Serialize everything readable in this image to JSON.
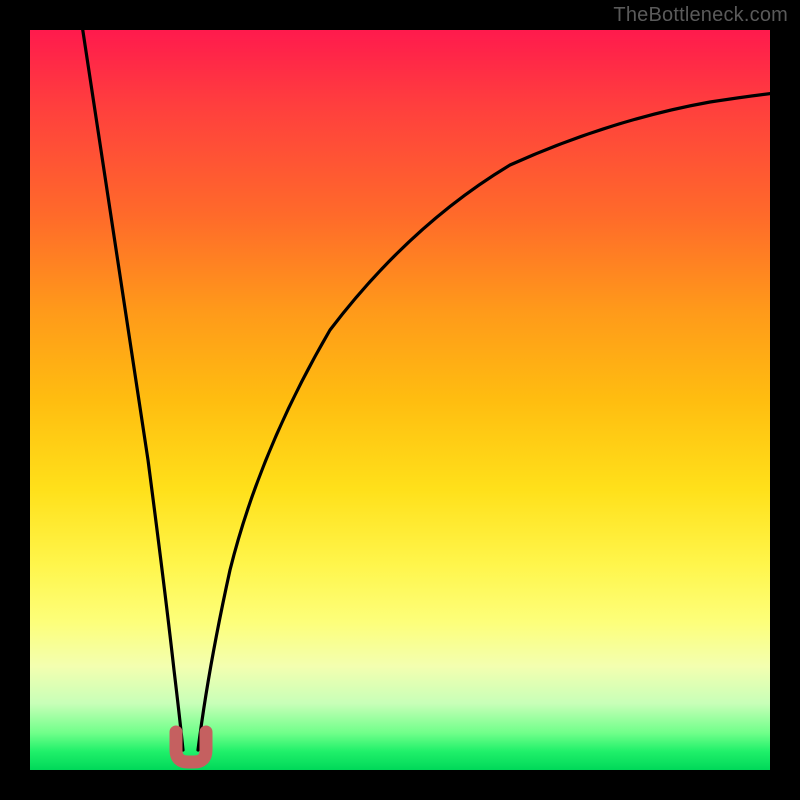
{
  "watermark": "TheBottleneck.com",
  "colors": {
    "frame": "#000000",
    "curve": "#000000",
    "marker": "#c56060",
    "gradient_top": "#ff1a4d",
    "gradient_bottom": "#00d859"
  },
  "chart_data": {
    "type": "line",
    "title": "",
    "xlabel": "",
    "ylabel": "",
    "xlim": [
      0,
      100
    ],
    "ylim": [
      0,
      100
    ],
    "grid": false,
    "legend": false,
    "note": "No axes, ticks, or labels are rendered. Gradient background encodes y-value (red high → green low). Values below are estimated from pixel geometry on a 0–100 scale; the curve minimum is near x≈21.",
    "series": [
      {
        "name": "curve",
        "color": "#000000",
        "x": [
          7,
          9,
          11,
          13,
          15,
          17,
          19,
          20,
          21,
          22,
          23,
          25,
          28,
          32,
          36,
          40,
          45,
          50,
          55,
          60,
          65,
          70,
          75,
          80,
          85,
          90,
          95,
          100
        ],
        "y": [
          100,
          88,
          76,
          63,
          50,
          36,
          18,
          8,
          2,
          2,
          8,
          21,
          35,
          48,
          57,
          63,
          69,
          74,
          78,
          81,
          83.5,
          85.5,
          87,
          88.2,
          89.2,
          90,
          90.6,
          91
        ]
      }
    ],
    "marker": {
      "name": "u-marker",
      "shape": "U",
      "color": "#c56060",
      "x_range": [
        19.5,
        23.5
      ],
      "y_range": [
        0.5,
        5
      ]
    }
  }
}
